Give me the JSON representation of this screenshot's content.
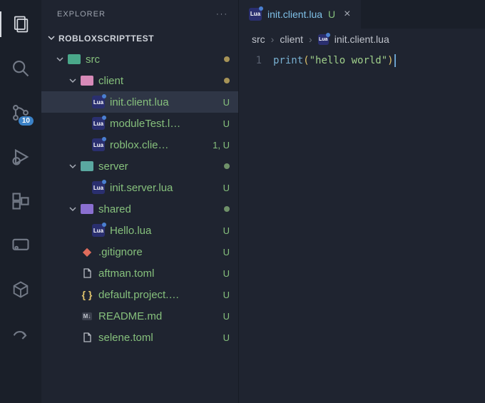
{
  "sidebar": {
    "title": "EXPLORER",
    "more": "···",
    "section": "ROBLOXSCRIPTTEST"
  },
  "activity": {
    "scm_badge": "10"
  },
  "tree": {
    "src": "src",
    "client": "client",
    "init_client": "init.client.lua",
    "moduleTest": "moduleTest.l…",
    "roblox_client": "roblox.clie…",
    "roblox_client_status": "1, U",
    "server": "server",
    "init_server": "init.server.lua",
    "shared": "shared",
    "hello": "Hello.lua",
    "gitignore": ".gitignore",
    "aftman": "aftman.toml",
    "default_project": "default.project.…",
    "readme": "README.md",
    "selene": "selene.toml",
    "status_U": "U"
  },
  "tab": {
    "title": "init.client.lua",
    "mod": "U"
  },
  "breadcrumbs": {
    "src": "src",
    "client": "client",
    "file": "init.client.lua"
  },
  "code": {
    "line1_num": "1",
    "fn": "print",
    "open": "(",
    "str": "\"hello world\"",
    "close": ")"
  }
}
